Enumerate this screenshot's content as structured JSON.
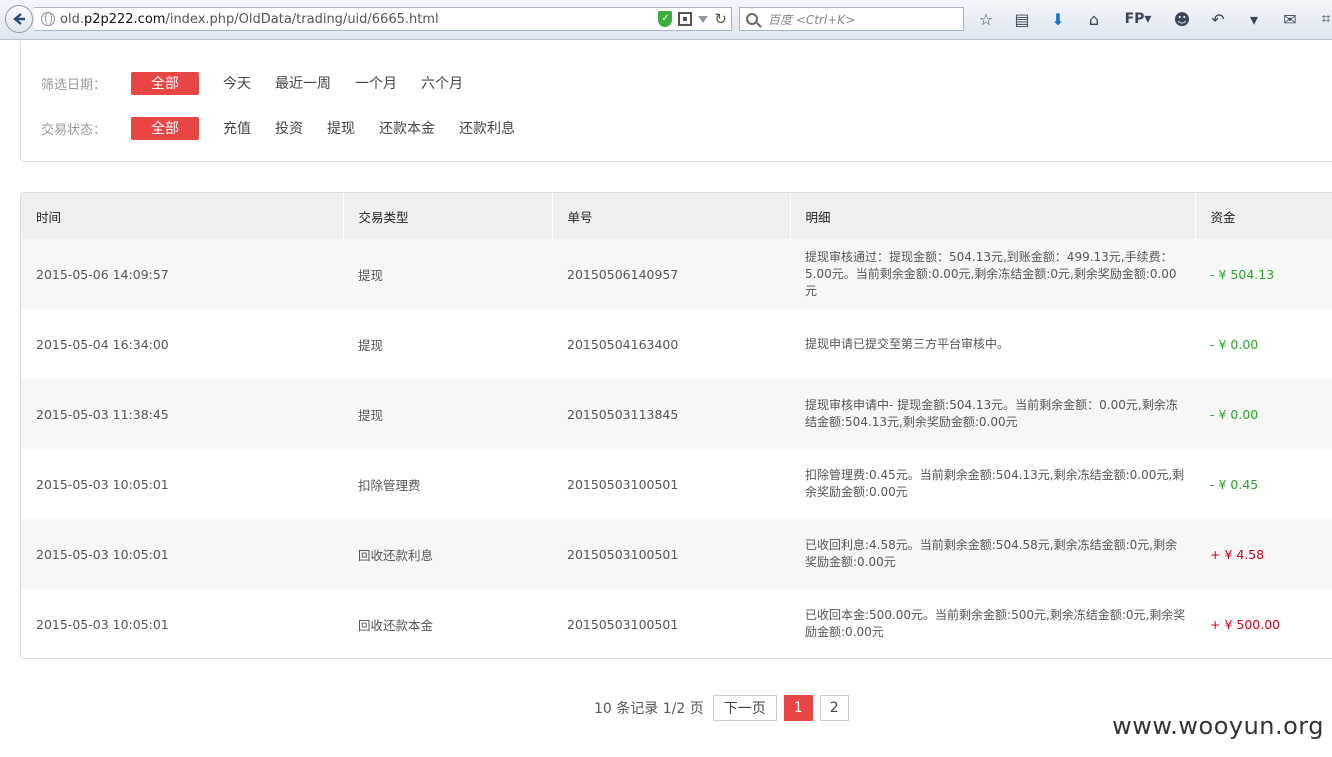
{
  "browser": {
    "url_prefix": "old.",
    "url_host": "p2p222.com",
    "url_path": "/index.php/OldData/trading/uid/6665.html",
    "search_placeholder": "百度 <Ctrl+K>",
    "fp_label": "FP"
  },
  "filters": {
    "date_label": "筛选日期：",
    "date_options": [
      "全部",
      "今天",
      "最近一周",
      "一个月",
      "六个月"
    ],
    "status_label": "交易状态：",
    "status_options": [
      "全部",
      "充值",
      "投资",
      "提现",
      "还款本金",
      "还款利息"
    ]
  },
  "table": {
    "headers": [
      "时间",
      "交易类型",
      "单号",
      "明细",
      "资金"
    ],
    "rows": [
      {
        "time": "2015-05-06 14:09:57",
        "type": "提现",
        "order": "20150506140957",
        "detail": "提现审核通过：提现金额：504.13元,到账金额：499.13元,手续费：5.00元。当前剩余金额:0.00元,剩余冻结金额:0元,剩余奖励金额:0.00元",
        "amount": "- ¥ 504.13",
        "sign": "neg"
      },
      {
        "time": "2015-05-04 16:34:00",
        "type": "提现",
        "order": "20150504163400",
        "detail": "提现申请已提交至第三方平台审核中。",
        "amount": "- ¥ 0.00",
        "sign": "neg"
      },
      {
        "time": "2015-05-03 11:38:45",
        "type": "提现",
        "order": "20150503113845",
        "detail": "提现审核申请中- 提现金额:504.13元。当前剩余金额：0.00元,剩余冻结金额:504.13元,剩余奖励金额:0.00元",
        "amount": "- ¥ 0.00",
        "sign": "neg"
      },
      {
        "time": "2015-05-03 10:05:01",
        "type": "扣除管理费",
        "order": "20150503100501",
        "detail": "扣除管理费:0.45元。当前剩余金额:504.13元,剩余冻结金额:0.00元,剩余奖励金额:0.00元",
        "amount": "- ¥ 0.45",
        "sign": "neg"
      },
      {
        "time": "2015-05-03 10:05:01",
        "type": "回收还款利息",
        "order": "20150503100501",
        "detail": "已收回利息:4.58元。当前剩余金额:504.58元,剩余冻结金额:0元,剩余奖励金额:0.00元",
        "amount": "+ ¥ 4.58",
        "sign": "pos"
      },
      {
        "time": "2015-05-03 10:05:01",
        "type": "回收还款本金",
        "order": "20150503100501",
        "detail": "已收回本金:500.00元。当前剩余金额:500元,剩余冻结金额:0元,剩余奖励金额:0.00元",
        "amount": "+ ¥ 500.00",
        "sign": "pos"
      }
    ]
  },
  "pagination": {
    "info": "10 条记录 1/2 页",
    "next_label": "下一页",
    "pages": [
      "1",
      "2"
    ],
    "current_page": "1"
  },
  "watermark": "www.wooyun.org",
  "colors": {
    "accent": "#e84545",
    "negative": "#2aa32a",
    "positive": "#d0021b"
  }
}
